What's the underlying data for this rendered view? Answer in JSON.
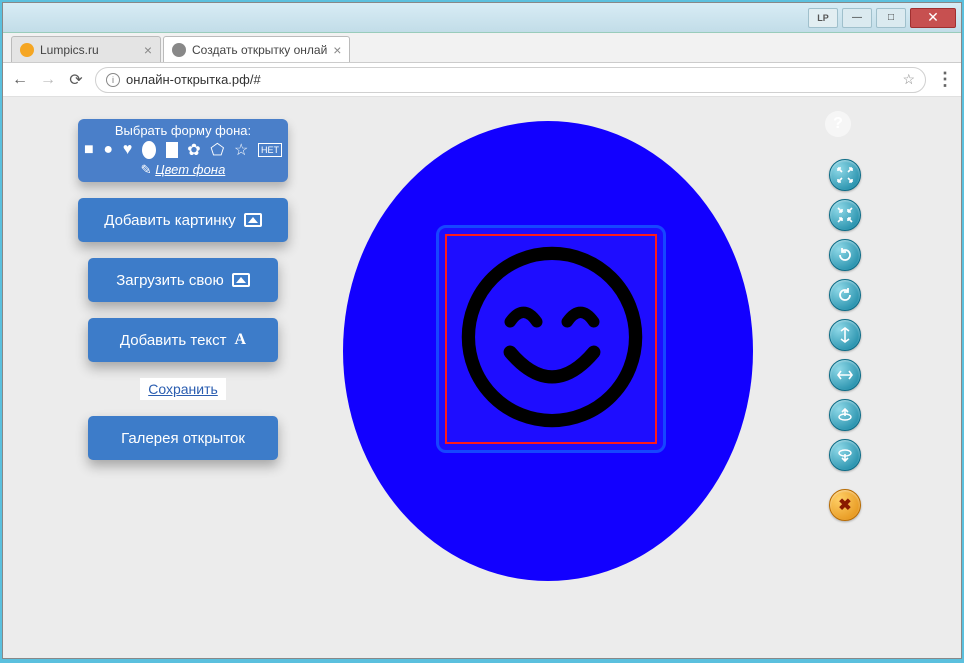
{
  "window": {
    "lp_label": "LP",
    "minimize": "—",
    "maximize": "□",
    "close": "✕"
  },
  "tabs": [
    {
      "title": "Lumpics.ru",
      "active": false
    },
    {
      "title": "Создать открытку онлай",
      "active": true
    }
  ],
  "addressbar": {
    "url": "онлайн-открытка.рф/#"
  },
  "shape_panel": {
    "title": "Выбрать форму фона:",
    "none_label": "НЕТ",
    "color_label": "Цвет фона"
  },
  "buttons": {
    "add_image": "Добавить картинку",
    "upload_own": "Загрузить свою",
    "add_text": "Добавить текст",
    "save": "Сохранить",
    "gallery": "Галерея открыток"
  },
  "canvas": {
    "bg_shape": "oval",
    "bg_color": "#1200ff",
    "selected_object": "smiley-face"
  },
  "tools": {
    "expand": "expand",
    "shrink": "shrink",
    "rotate_ccw": "rotate-ccw",
    "rotate_cw": "rotate-cw",
    "flip_v": "flip-vertical",
    "flip_h": "flip-horizontal",
    "layer_up": "bring-forward",
    "layer_down": "send-backward",
    "delete": "delete"
  },
  "help": "?"
}
